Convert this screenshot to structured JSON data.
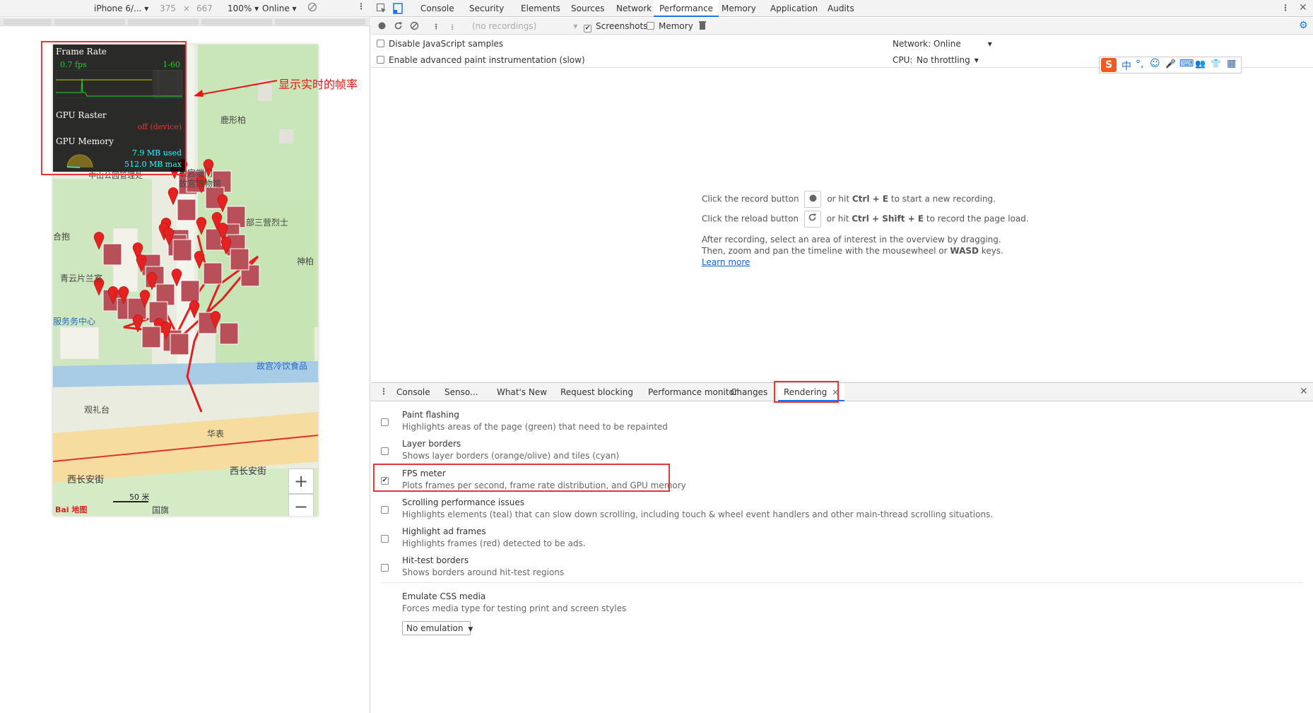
{
  "device_toolbar": {
    "device": "iPhone 6/...",
    "width": "375",
    "times": "×",
    "height": "667",
    "zoom": "100%",
    "throttle": "Online"
  },
  "fps_meter": {
    "frame_rate_label": "Frame Rate",
    "fps_value": "0.7 fps",
    "fps_range": "1-60",
    "gpu_raster_label": "GPU Raster",
    "gpu_raster_status": "off (device)",
    "gpu_memory_label": "GPU Memory",
    "gpu_used": "7.9 MB used",
    "gpu_max": "512.0 MB max",
    "memory_fraction": 0.015
  },
  "annotation": "显示实时的帧率",
  "map": {
    "labels": [
      "鹿形柏",
      "故宫端门",
      "故宫博物馆",
      "部三营烈士",
      "合抱",
      "神柏",
      "青云片兰室",
      "服务务中心",
      "故宫冷饮食品",
      "观礼台",
      "华表",
      "西长安街",
      "西长安街",
      "国旗",
      "中山公园管理处"
    ],
    "scale": "50 米",
    "logo": "Bai 地图",
    "zoom_in": "+",
    "zoom_out": "−"
  },
  "main_tabs": [
    "Console",
    "Security",
    "Elements",
    "Sources",
    "Network",
    "Performance",
    "Memory",
    "Application",
    "Audits"
  ],
  "active_main_tab": "Performance",
  "perf_toolbar": {
    "recordings": "(no recordings)",
    "screenshots": "Screenshots",
    "memory": "Memory"
  },
  "perf_options": {
    "disable_js": "Disable JavaScript samples",
    "advanced_paint": "Enable advanced paint instrumentation (slow)",
    "network_label": "Network:",
    "network_value": "Online",
    "cpu_label": "CPU:",
    "cpu_value": "No throttling"
  },
  "ime_bar": [
    "S",
    "中",
    "°,",
    "☺",
    "🎤",
    "⌨",
    "👥",
    "👕",
    "▦"
  ],
  "empty_state": {
    "record_prefix": "Click the record button",
    "record_suffix_pre": "or hit ",
    "record_keys": "Ctrl + E",
    "record_suffix_post": " to start a new recording.",
    "reload_prefix": "Click the reload button",
    "reload_suffix_pre": "or hit ",
    "reload_keys": "Ctrl + Shift + E",
    "reload_suffix_post": " to record the page load.",
    "after_1": "After recording, select an area of interest in the overview by dragging.",
    "after_2_pre": "Then, zoom and pan the timeline with the mousewheel or ",
    "after_2_keys": "WASD",
    "after_2_post": " keys.",
    "learn_more": "Learn more"
  },
  "drawer_tabs": [
    "Console",
    "Senso...",
    "What's New",
    "Request blocking",
    "Performance monitor",
    "Changes",
    "Rendering"
  ],
  "active_drawer_tab": "Rendering",
  "rendering": {
    "items": [
      {
        "title": "Paint flashing",
        "desc": "Highlights areas of the page (green) that need to be repainted",
        "checked": false
      },
      {
        "title": "Layer borders",
        "desc": "Shows layer borders (orange/olive) and tiles (cyan)",
        "checked": false
      },
      {
        "title": "FPS meter",
        "desc": "Plots frames per second, frame rate distribution, and GPU memory",
        "checked": true
      },
      {
        "title": "Scrolling performance issues",
        "desc": "Highlights elements (teal) that can slow down scrolling, including touch & wheel event handlers and other main-thread scrolling situations.",
        "checked": false
      },
      {
        "title": "Highlight ad frames",
        "desc": "Highlights frames (red) detected to be ads.",
        "checked": false
      },
      {
        "title": "Hit-test borders",
        "desc": "Shows borders around hit-test regions",
        "checked": false
      }
    ],
    "emulate_title": "Emulate CSS media",
    "emulate_desc": "Forces media type for testing print and screen styles",
    "emulate_value": "No emulation"
  },
  "colors": {
    "accent": "#1a73e8",
    "highlight_box": "#e33",
    "fps_green": "#24d024",
    "fps_cyan": "#2ff"
  }
}
